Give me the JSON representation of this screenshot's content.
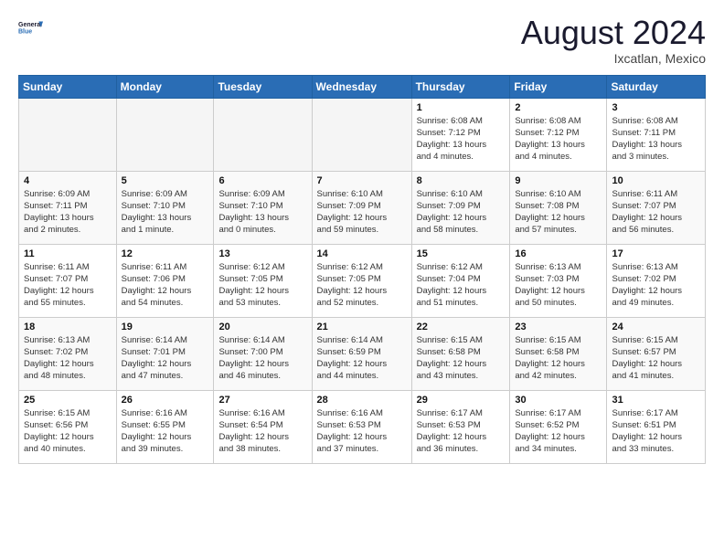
{
  "header": {
    "logo_line1": "General",
    "logo_line2": "Blue",
    "month_title": "August 2024",
    "subtitle": "Ixcatlan, Mexico"
  },
  "weekdays": [
    "Sunday",
    "Monday",
    "Tuesday",
    "Wednesday",
    "Thursday",
    "Friday",
    "Saturday"
  ],
  "weeks": [
    [
      {
        "day": "",
        "info": ""
      },
      {
        "day": "",
        "info": ""
      },
      {
        "day": "",
        "info": ""
      },
      {
        "day": "",
        "info": ""
      },
      {
        "day": "1",
        "info": "Sunrise: 6:08 AM\nSunset: 7:12 PM\nDaylight: 13 hours\nand 4 minutes."
      },
      {
        "day": "2",
        "info": "Sunrise: 6:08 AM\nSunset: 7:12 PM\nDaylight: 13 hours\nand 4 minutes."
      },
      {
        "day": "3",
        "info": "Sunrise: 6:08 AM\nSunset: 7:11 PM\nDaylight: 13 hours\nand 3 minutes."
      }
    ],
    [
      {
        "day": "4",
        "info": "Sunrise: 6:09 AM\nSunset: 7:11 PM\nDaylight: 13 hours\nand 2 minutes."
      },
      {
        "day": "5",
        "info": "Sunrise: 6:09 AM\nSunset: 7:10 PM\nDaylight: 13 hours\nand 1 minute."
      },
      {
        "day": "6",
        "info": "Sunrise: 6:09 AM\nSunset: 7:10 PM\nDaylight: 13 hours\nand 0 minutes."
      },
      {
        "day": "7",
        "info": "Sunrise: 6:10 AM\nSunset: 7:09 PM\nDaylight: 12 hours\nand 59 minutes."
      },
      {
        "day": "8",
        "info": "Sunrise: 6:10 AM\nSunset: 7:09 PM\nDaylight: 12 hours\nand 58 minutes."
      },
      {
        "day": "9",
        "info": "Sunrise: 6:10 AM\nSunset: 7:08 PM\nDaylight: 12 hours\nand 57 minutes."
      },
      {
        "day": "10",
        "info": "Sunrise: 6:11 AM\nSunset: 7:07 PM\nDaylight: 12 hours\nand 56 minutes."
      }
    ],
    [
      {
        "day": "11",
        "info": "Sunrise: 6:11 AM\nSunset: 7:07 PM\nDaylight: 12 hours\nand 55 minutes."
      },
      {
        "day": "12",
        "info": "Sunrise: 6:11 AM\nSunset: 7:06 PM\nDaylight: 12 hours\nand 54 minutes."
      },
      {
        "day": "13",
        "info": "Sunrise: 6:12 AM\nSunset: 7:05 PM\nDaylight: 12 hours\nand 53 minutes."
      },
      {
        "day": "14",
        "info": "Sunrise: 6:12 AM\nSunset: 7:05 PM\nDaylight: 12 hours\nand 52 minutes."
      },
      {
        "day": "15",
        "info": "Sunrise: 6:12 AM\nSunset: 7:04 PM\nDaylight: 12 hours\nand 51 minutes."
      },
      {
        "day": "16",
        "info": "Sunrise: 6:13 AM\nSunset: 7:03 PM\nDaylight: 12 hours\nand 50 minutes."
      },
      {
        "day": "17",
        "info": "Sunrise: 6:13 AM\nSunset: 7:02 PM\nDaylight: 12 hours\nand 49 minutes."
      }
    ],
    [
      {
        "day": "18",
        "info": "Sunrise: 6:13 AM\nSunset: 7:02 PM\nDaylight: 12 hours\nand 48 minutes."
      },
      {
        "day": "19",
        "info": "Sunrise: 6:14 AM\nSunset: 7:01 PM\nDaylight: 12 hours\nand 47 minutes."
      },
      {
        "day": "20",
        "info": "Sunrise: 6:14 AM\nSunset: 7:00 PM\nDaylight: 12 hours\nand 46 minutes."
      },
      {
        "day": "21",
        "info": "Sunrise: 6:14 AM\nSunset: 6:59 PM\nDaylight: 12 hours\nand 44 minutes."
      },
      {
        "day": "22",
        "info": "Sunrise: 6:15 AM\nSunset: 6:58 PM\nDaylight: 12 hours\nand 43 minutes."
      },
      {
        "day": "23",
        "info": "Sunrise: 6:15 AM\nSunset: 6:58 PM\nDaylight: 12 hours\nand 42 minutes."
      },
      {
        "day": "24",
        "info": "Sunrise: 6:15 AM\nSunset: 6:57 PM\nDaylight: 12 hours\nand 41 minutes."
      }
    ],
    [
      {
        "day": "25",
        "info": "Sunrise: 6:15 AM\nSunset: 6:56 PM\nDaylight: 12 hours\nand 40 minutes."
      },
      {
        "day": "26",
        "info": "Sunrise: 6:16 AM\nSunset: 6:55 PM\nDaylight: 12 hours\nand 39 minutes."
      },
      {
        "day": "27",
        "info": "Sunrise: 6:16 AM\nSunset: 6:54 PM\nDaylight: 12 hours\nand 38 minutes."
      },
      {
        "day": "28",
        "info": "Sunrise: 6:16 AM\nSunset: 6:53 PM\nDaylight: 12 hours\nand 37 minutes."
      },
      {
        "day": "29",
        "info": "Sunrise: 6:17 AM\nSunset: 6:53 PM\nDaylight: 12 hours\nand 36 minutes."
      },
      {
        "day": "30",
        "info": "Sunrise: 6:17 AM\nSunset: 6:52 PM\nDaylight: 12 hours\nand 34 minutes."
      },
      {
        "day": "31",
        "info": "Sunrise: 6:17 AM\nSunset: 6:51 PM\nDaylight: 12 hours\nand 33 minutes."
      }
    ]
  ]
}
